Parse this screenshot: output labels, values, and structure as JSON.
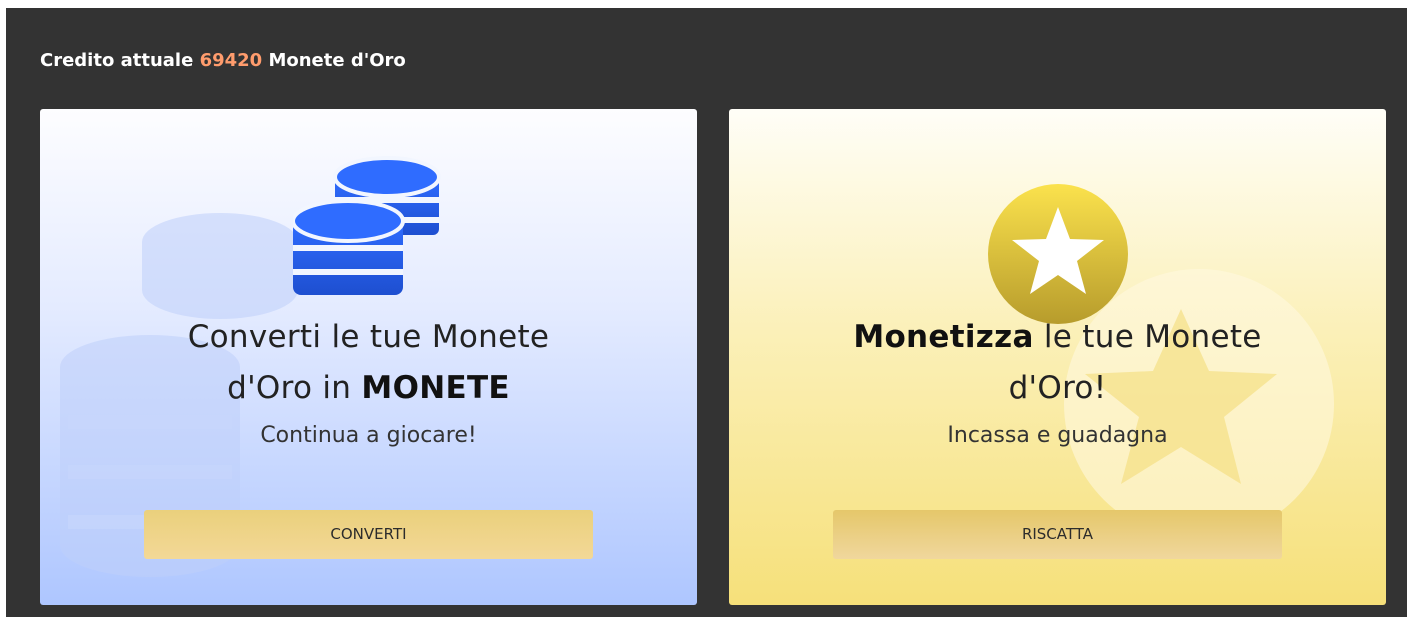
{
  "credit": {
    "prefix": "Credito attuale",
    "amount": "69420",
    "suffix": "Monete d'Oro"
  },
  "cards": [
    {
      "icon": "coin-stack-icon",
      "title_line1": "Converti le tue Monete",
      "title_line2_plain": "d'Oro in ",
      "title_line2_bold": "MONETE",
      "subtitle": "Continua a giocare!",
      "button_label": "CONVERTI"
    },
    {
      "icon": "gold-star-coin-icon",
      "title_line1_bold": "Monetizza",
      "title_line1_plain": " le tue Monete",
      "title_line2_plain": "d'Oro!",
      "subtitle": "Incassa e guadagna",
      "button_label": "RISCATTA"
    }
  ],
  "colors": {
    "background": "#333333",
    "credit_amount": "#ff9c6d",
    "coin_blue": "#2f6cff",
    "gold": "#e5c76a"
  }
}
